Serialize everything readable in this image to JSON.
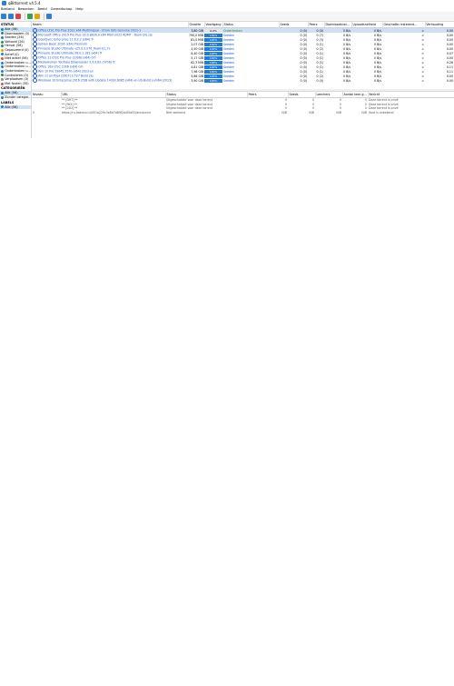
{
  "window": {
    "title": "qBittorrent v4.5.4"
  },
  "menu": [
    "Bestand",
    "Bewerken",
    "Beeld",
    "Gereedschap",
    "Help"
  ],
  "sidebar": {
    "status_header": "STATUS",
    "status_items": [
      {
        "label": "Alle (56)",
        "color": "#1e7be0",
        "selected": true
      },
      {
        "label": "Downloaden (0)",
        "color": "#2e8b57"
      },
      {
        "label": "Seeden (26)",
        "color": "#1e7be0"
      },
      {
        "label": "Voltooid (26)",
        "color": "#2e8b57"
      },
      {
        "label": "Hervat (56)",
        "color": "#2e8b57"
      },
      {
        "label": "Gepauzeerd (0)",
        "color": "#e0a800"
      },
      {
        "label": "Actief (0)",
        "color": "#1e7be0"
      },
      {
        "label": "Niet actief (56)",
        "color": "#d9534f"
      },
      {
        "label": "Onderbroken u...",
        "color": "#1e7be0"
      },
      {
        "label": "Onderbroken u...",
        "color": "#1e7be0"
      },
      {
        "label": "Onderbroken u...",
        "color": "#1e7be0"
      },
      {
        "label": "Controleren (0)",
        "color": "#2e8b57"
      },
      {
        "label": "Verplaatsen (0)",
        "color": "#888888"
      },
      {
        "label": "Met fouten (30)",
        "color": "#d9534f"
      }
    ],
    "cat_header": "CATEGORIEËN",
    "cat_items": [
      {
        "label": "Alle (56)",
        "selected": true
      },
      {
        "label": "Zonder categor..."
      }
    ],
    "label_header": "LABELS",
    "label_items": [
      {
        "label": "Alle (56)",
        "selected": true
      }
    ]
  },
  "torrents": {
    "columns": [
      "Naam",
      "Grootte",
      "Voortgang",
      "Status",
      "Seeds",
      "Peers",
      "Downloadsnel...",
      "Uploadsnelheid",
      "Geschatte resterend...",
      "Verhouding"
    ],
    "rows": [
      {
        "name": "Office LTSC Pro Plus 2021 x64 Multilingual - (from ISO) Genuine 2021-1",
        "size": "3,80 GiB",
        "progress": 0.0,
        "progress_label": "0.0%",
        "status": "Onderbroken",
        "seeds": "0 (0)",
        "peers": "0 (0)",
        "down": "0 B/s",
        "up": "0 B/s",
        "eta": "∞",
        "ratio": "0.00",
        "selected": true
      },
      {
        "name": "Microsoft Office 2019 Pro Plus 16.0.8826.0 x64 MSO 2022 ADMT - Team DG.zip",
        "size": "790,0 MiB",
        "progress": 1.0,
        "progress_label": "100%",
        "status": "Seeden",
        "seeds": "0 (0)",
        "peers": "0 (7)",
        "down": "0 B/s",
        "up": "0 B/s",
        "eta": "∞",
        "ratio": "0.00"
      },
      {
        "name": "GoodSync Enterprise 11.6.2.2 (x64) Tr",
        "size": "61,0 MiB",
        "progress": 1.0,
        "progress_label": "100%",
        "status": "Seeden",
        "seeds": "0 (0)",
        "peers": "0 (3)",
        "down": "0 B/s",
        "up": "0 B/s",
        "eta": "∞",
        "ratio": "0.00"
      },
      {
        "name": "Sohlen Basic 2024 (x64) Premium",
        "size": "2,07 GiB",
        "progress": 1.0,
        "progress_label": "100%",
        "status": "Seeden",
        "seeds": "0 (0)",
        "peers": "0 (1)",
        "down": "0 B/s",
        "up": "0 B/s",
        "eta": "∞",
        "ratio": "0.00"
      },
      {
        "name": "Pinnacle Studio Ultimate v25.0.2.276_Team-EC.7z",
        "size": "4,50 GiB",
        "progress": 1.0,
        "progress_label": "100%",
        "status": "Seeden",
        "seeds": "0 (0)",
        "peers": "0 (2)",
        "down": "0 B/s",
        "up": "0 B/s",
        "eta": "∞",
        "ratio": "0.00"
      },
      {
        "name": "Pinnacle Studio Ultimate 26.0.1.181 (x64) Tr",
        "size": "8,40 GiB",
        "progress": 1.0,
        "progress_label": "100%",
        "status": "Seeden",
        "seeds": "0 (0)",
        "peers": "0 (1)",
        "down": "0 B/s",
        "up": "0 B/s",
        "eta": "∞",
        "ratio": "0.07"
      },
      {
        "name": "Office 21 LTSC Pro Plus (2306) (x64) GO",
        "size": "5,17 GiB",
        "progress": 1.0,
        "progress_label": "100%",
        "status": "Seeden",
        "seeds": "0 (0)",
        "peers": "0 (1)",
        "down": "0 B/s",
        "up": "0 B/s",
        "eta": "∞",
        "ratio": "0.00"
      },
      {
        "name": "MediaHuman YouTube Downloader 3.9.9.82 (0706) Tr",
        "size": "62,3 MiB",
        "progress": 1.0,
        "progress_label": "100%",
        "status": "Seeden",
        "seeds": "0 (0)",
        "peers": "0 (1)",
        "down": "0 B/s",
        "up": "0 B/s",
        "eta": "∞",
        "ratio": "0.26"
      },
      {
        "name": "Office 16x LTSC 2306 (x64) GO",
        "size": "4,81 GiB",
        "progress": 1.0,
        "progress_label": "100%",
        "status": "Seeden",
        "seeds": "0 (0)",
        "peers": "0 (1)",
        "down": "0 B/s",
        "up": "0 B/s",
        "eta": "∞",
        "ratio": "0.11"
      },
      {
        "name": "Win 10 Pro 19045.3570 (x64) 2023 en",
        "size": "7,98 GiB",
        "progress": 1.0,
        "progress_label": "100%",
        "status": "Seeden",
        "seeds": "0 (0)",
        "peers": "0 (1)",
        "down": "0 B/s",
        "up": "0 B/s",
        "eta": "∞",
        "ratio": "0.11"
      },
      {
        "name": "Win 11 en-fbox (2307) 17/27 Build zip",
        "size": "5,86 GiB",
        "progress": 1.0,
        "progress_label": "100%",
        "status": "Seeden",
        "seeds": "0 (0)",
        "peers": "0 (2)",
        "down": "0 B/s",
        "up": "0 B/s",
        "eta": "∞",
        "ratio": "0.00"
      },
      {
        "name": "Windows 10 Enterprise 2016 LTSB with Update 14393.6085 (x64) en-US Build sum64 (2023)",
        "size": "3,90 GiB",
        "progress": 1.0,
        "progress_label": "100%",
        "status": "Seeden",
        "seeds": "0 (0)",
        "peers": "0 (0)",
        "down": "0 B/s",
        "up": "0 B/s",
        "eta": "∞",
        "ratio": "0.00"
      }
    ]
  },
  "trackers": {
    "columns": [
      "Niveau",
      "URL",
      "Status",
      "Peers",
      "Seeds",
      "Leechers",
      "Aantal keer g...",
      "Bericht"
    ],
    "rows": [
      {
        "tier": "",
        "url": "** [DHT] **",
        "status": "Uitgeschakeld voor deze torrent",
        "peers": "0",
        "seeds": "0",
        "leechers": "0",
        "downloaded": "0",
        "message": "Deze torrent is privé"
      },
      {
        "tier": "",
        "url": "** [PeX] **",
        "status": "Uitgeschakeld voor deze torrent",
        "peers": "0",
        "seeds": "0",
        "leechers": "0",
        "downloaded": "0",
        "message": "Deze torrent is privé"
      },
      {
        "tier": "",
        "url": "** [LSD] **",
        "status": "Uitgeschakeld voor deze torrent",
        "peers": "0",
        "seeds": "0",
        "leechers": "0",
        "downloaded": "0",
        "message": "Deze torrent is privé"
      },
      {
        "tier": "0",
        "url": "https://ru.itaenco.ru/001a229c3e6d7d89f2d4f5d00/announce",
        "status": "Niet werkend",
        "peers": "N/B",
        "seeds": "N/B",
        "leechers": "N/B",
        "downloaded": "N/B",
        "message": "Host is onbekend"
      }
    ]
  }
}
